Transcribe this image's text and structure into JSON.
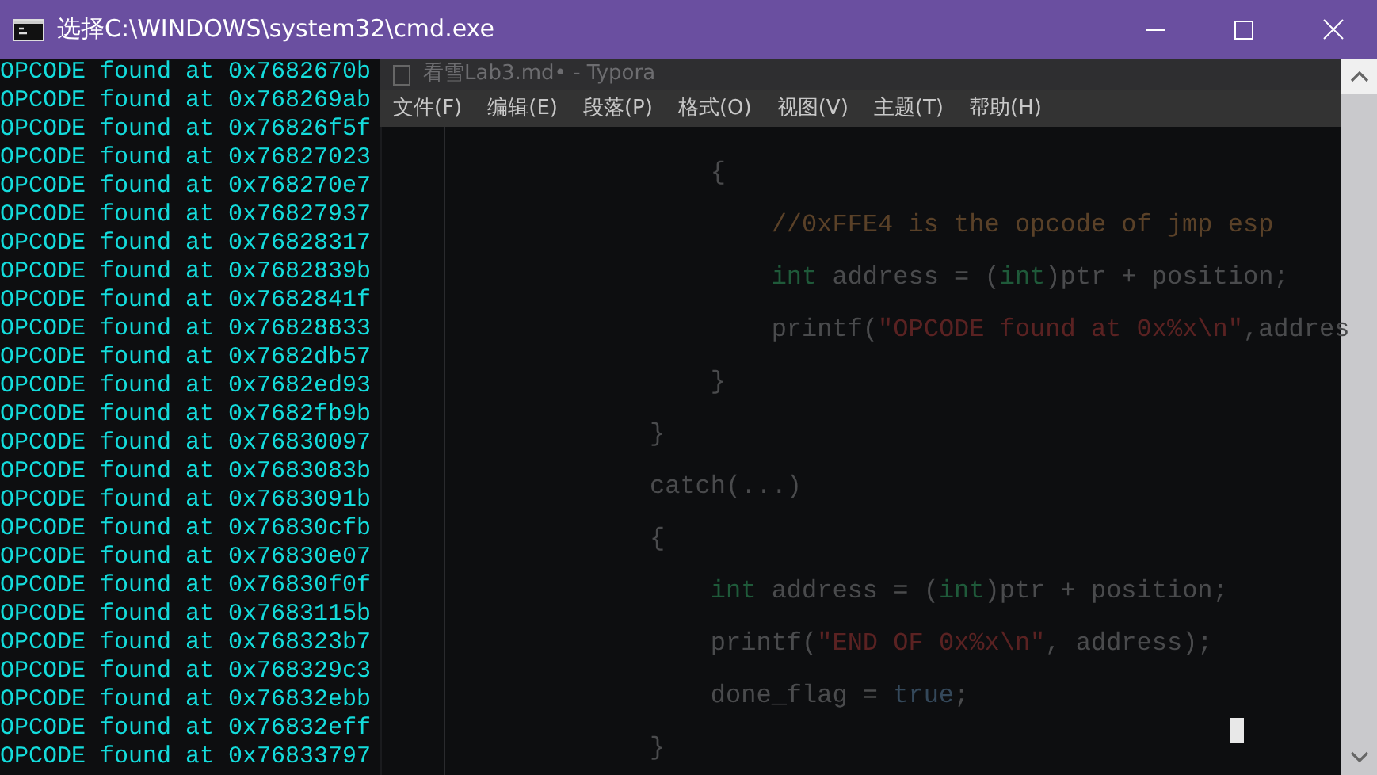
{
  "console": {
    "title": "选择C:\\WINDOWS\\system32\\cmd.exe",
    "lines": [
      "OPCODE found at 0x7682670b",
      "OPCODE found at 0x768269ab",
      "OPCODE found at 0x76826f5f",
      "OPCODE found at 0x76827023",
      "OPCODE found at 0x768270e7",
      "OPCODE found at 0x76827937",
      "OPCODE found at 0x76828317",
      "OPCODE found at 0x7682839b",
      "OPCODE found at 0x7682841f",
      "OPCODE found at 0x76828833",
      "OPCODE found at 0x7682db57",
      "OPCODE found at 0x7682ed93",
      "OPCODE found at 0x7682fb9b",
      "OPCODE found at 0x76830097",
      "OPCODE found at 0x7683083b",
      "OPCODE found at 0x7683091b",
      "OPCODE found at 0x76830cfb",
      "OPCODE found at 0x76830e07",
      "OPCODE found at 0x76830f0f",
      "OPCODE found at 0x7683115b",
      "OPCODE found at 0x768323b7",
      "OPCODE found at 0x768329c3",
      "OPCODE found at 0x76832ebb",
      "OPCODE found at 0x76832eff",
      "OPCODE found at 0x76833797"
    ]
  },
  "editor": {
    "title": "看雪Lab3.md• - Typora",
    "menu": [
      "文件(F)",
      "编辑(E)",
      "段落(P)",
      "格式(O)",
      "视图(V)",
      "主题(T)",
      "帮助(H)"
    ],
    "code_lines": [
      {
        "segments": [
          {
            "kind": "plain",
            "text": "    {"
          }
        ]
      },
      {
        "segments": [
          {
            "kind": "comment",
            "text": "        //0xFFE4 is the opcode of jmp esp"
          }
        ]
      },
      {
        "segments": [
          {
            "kind": "keyword",
            "text": "        int"
          },
          {
            "kind": "plain",
            "text": " address = ("
          },
          {
            "kind": "keyword",
            "text": "int"
          },
          {
            "kind": "plain",
            "text": ")ptr + position;"
          }
        ]
      },
      {
        "segments": [
          {
            "kind": "plain",
            "text": "        printf("
          },
          {
            "kind": "string",
            "text": "\"OPCODE found at 0x%x\\n\""
          },
          {
            "kind": "plain",
            "text": ",addres"
          }
        ]
      },
      {
        "segments": [
          {
            "kind": "plain",
            "text": "    }"
          }
        ]
      },
      {
        "segments": [
          {
            "kind": "plain",
            "text": "}"
          }
        ]
      },
      {
        "segments": [
          {
            "kind": "plain",
            "text": "catch(...)"
          }
        ]
      },
      {
        "segments": [
          {
            "kind": "plain",
            "text": "{"
          }
        ]
      },
      {
        "segments": [
          {
            "kind": "keyword",
            "text": "    int"
          },
          {
            "kind": "plain",
            "text": " address = ("
          },
          {
            "kind": "keyword",
            "text": "int"
          },
          {
            "kind": "plain",
            "text": ")ptr + position;"
          }
        ]
      },
      {
        "segments": [
          {
            "kind": "plain",
            "text": "    printf("
          },
          {
            "kind": "string",
            "text": "\"END OF 0x%x\\n\""
          },
          {
            "kind": "plain",
            "text": ", address);"
          }
        ]
      },
      {
        "segments": [
          {
            "kind": "plain",
            "text": "    done_flag = "
          },
          {
            "kind": "literal",
            "text": "true"
          },
          {
            "kind": "plain",
            "text": ";"
          }
        ]
      },
      {
        "segments": [
          {
            "kind": "plain",
            "text": "}"
          }
        ]
      }
    ]
  }
}
